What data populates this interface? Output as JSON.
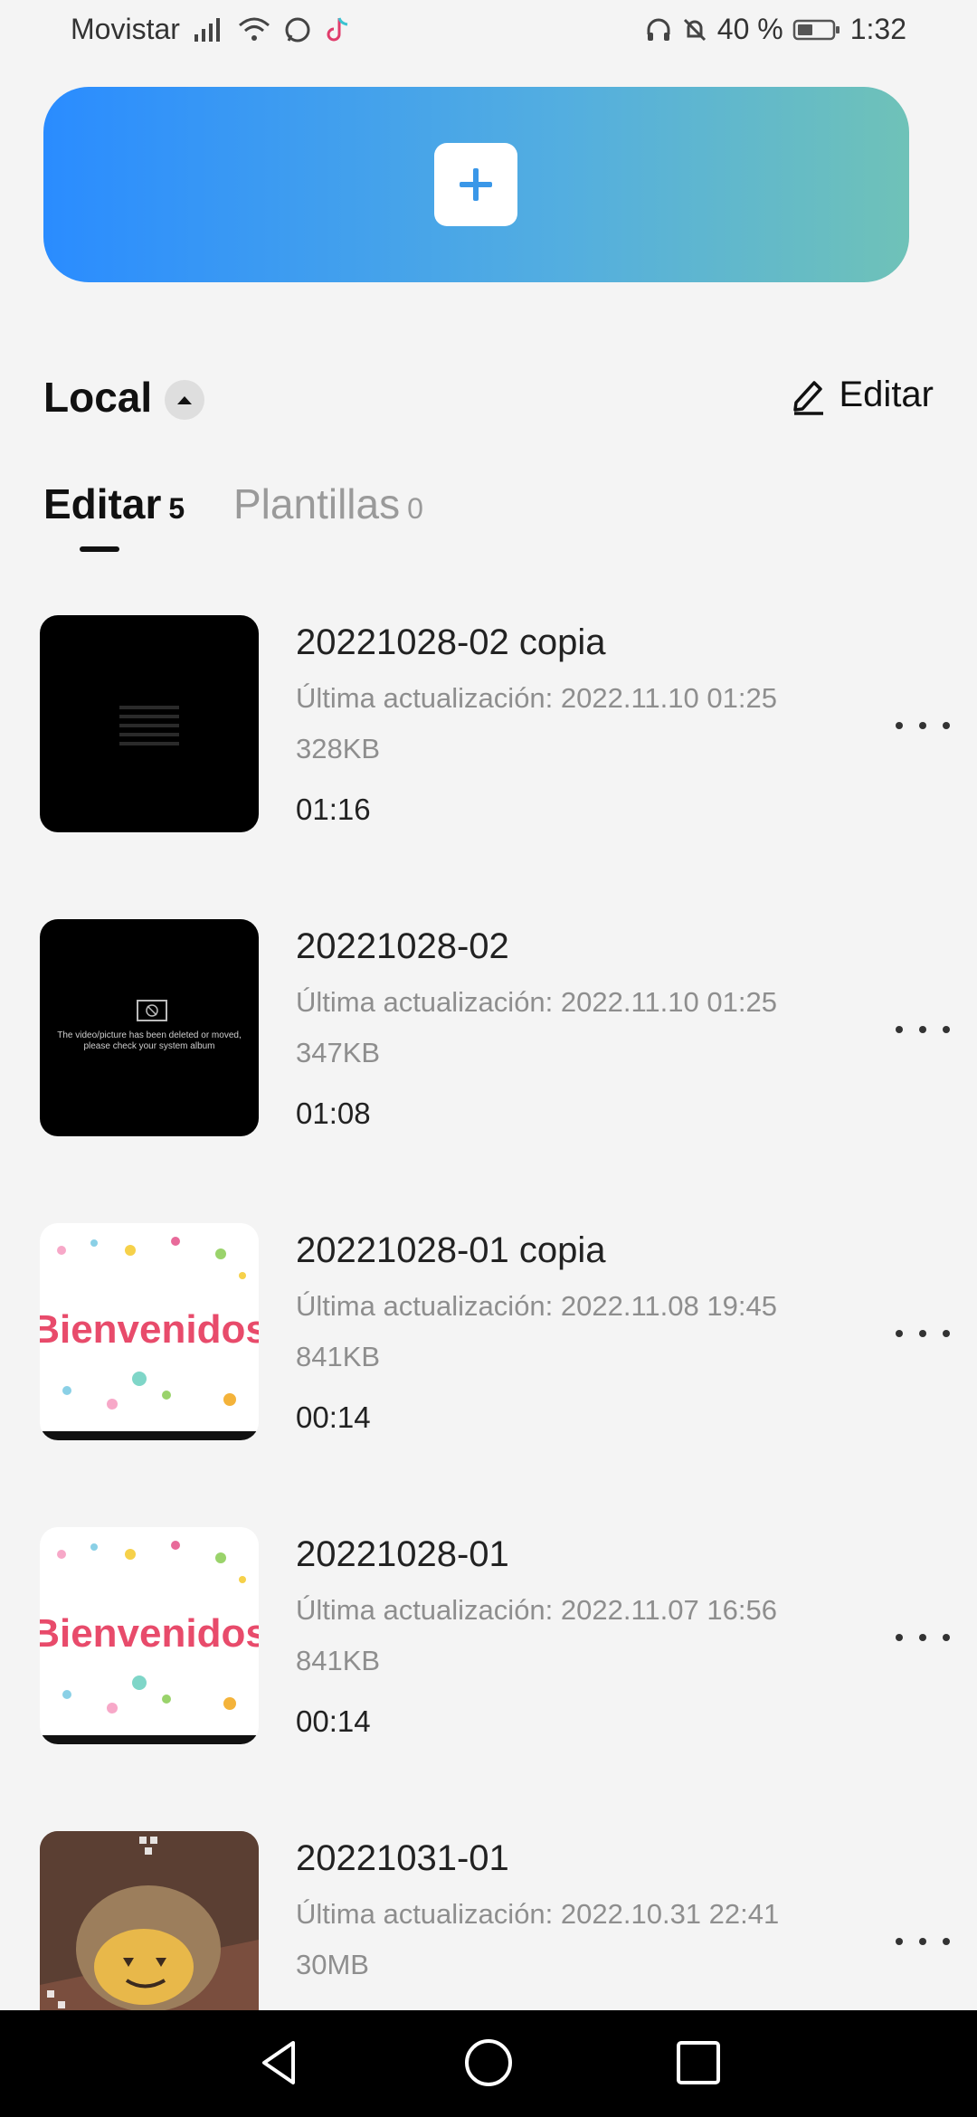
{
  "status_bar": {
    "carrier": "Movistar",
    "battery": "40 %",
    "time": "1:32"
  },
  "create_button": {
    "icon": "plus-icon"
  },
  "section": {
    "title": "Local",
    "edit_label": "Editar"
  },
  "tabs": [
    {
      "label": "Editar",
      "count": "5",
      "active": true
    },
    {
      "label": "Plantillas",
      "count": "0",
      "active": false
    }
  ],
  "projects": [
    {
      "title": "20221028-02 copia",
      "updated": "Última actualización: 2022.11.10 01:25",
      "size": "328KB",
      "duration": "01:16",
      "thumb": "black-grid"
    },
    {
      "title": "20221028-02",
      "updated": "Última actualización: 2022.11.10 01:25",
      "size": "347KB",
      "duration": "01:08",
      "thumb": "deleted-notice",
      "thumb_text": "The video/picture has been deleted or moved, please check your system album"
    },
    {
      "title": "20221028-01 copia",
      "updated": "Última actualización: 2022.11.08 19:45",
      "size": "841KB",
      "duration": "00:14",
      "thumb": "bienvenidos",
      "thumb_text": "Bienvenidos"
    },
    {
      "title": "20221028-01",
      "updated": "Última actualización: 2022.11.07 16:56",
      "size": "841KB",
      "duration": "00:14",
      "thumb": "bienvenidos",
      "thumb_text": "Bienvenidos"
    },
    {
      "title": "20221031-01",
      "updated": "Última actualización: 2022.10.31 22:41",
      "size": "30MB",
      "duration": "",
      "thumb": "dog-photo"
    }
  ],
  "nav": {
    "back": "back-icon",
    "home": "home-icon",
    "recents": "recents-icon"
  },
  "colors": {
    "accent_start": "#2a8cff",
    "accent_end": "#6fc2b8"
  }
}
